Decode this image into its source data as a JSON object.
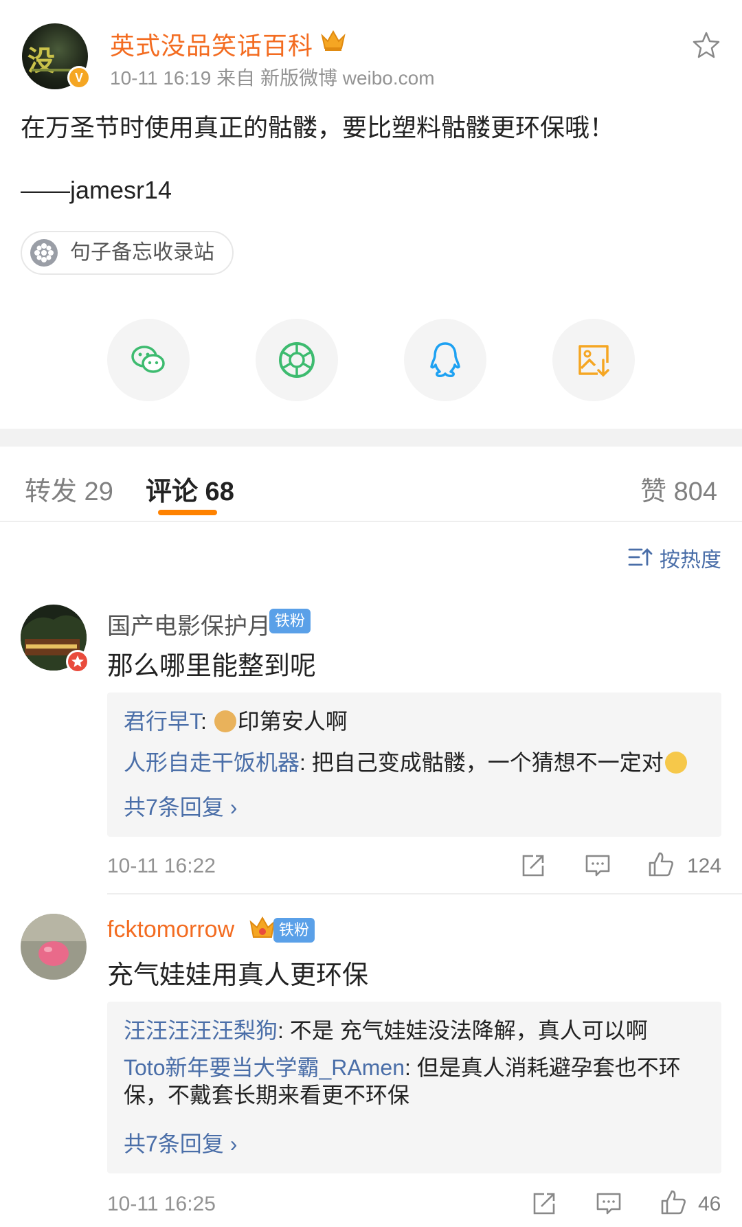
{
  "post": {
    "author_name": "英式没品笑话百科",
    "vip_badge": "V",
    "avatar_title": "没",
    "meta": "10-11 16:19  来自 新版微博 weibo.com",
    "text": "在万圣节时使用真正的骷髅，要比塑料骷髅更环保哦！",
    "signature": "——jamesr14",
    "topic": "句子备忘收录站"
  },
  "share": [
    {
      "icon": "wechat-icon",
      "color": "#3dbb6f"
    },
    {
      "icon": "moments-icon",
      "color": "#3dbb6f"
    },
    {
      "icon": "qq-icon",
      "color": "#1da1f2"
    },
    {
      "icon": "save-image-icon",
      "color": "#f5a623"
    }
  ],
  "tabs": {
    "repost": "转发 29",
    "comments": "评论 68",
    "likes": "赞 804"
  },
  "sort": {
    "label": "按热度"
  },
  "comments": [
    {
      "name": "国产电影保护月",
      "badge": "铁粉",
      "text": "那么哪里能整到呢",
      "replies": [
        {
          "user": "君行早T",
          "text": "印第安人啊"
        },
        {
          "user": "人形自走干饭机器",
          "text": "把自己变成骷髅，一个猜想不一定对"
        }
      ],
      "more": "共7条回复 ›",
      "time": "10-11 16:22",
      "likes": "124"
    },
    {
      "name": "fcktomorrow",
      "badge": "铁粉",
      "text": "充气娃娃用真人更环保",
      "replies": [
        {
          "user": "汪汪汪汪汪梨狗",
          "text": "不是 充气娃娃没法降解，真人可以啊"
        },
        {
          "user": "Toto新年要当大学霸_RAmen",
          "text": "但是真人消耗避孕套也不环保，不戴套长期来看更不环保"
        }
      ],
      "more": "共7条回复 ›",
      "time": "10-11 16:25",
      "likes": "46"
    }
  ],
  "colors": {
    "accent_orange": "#ff8200",
    "author_orange": "#f36c21",
    "link_blue": "#4a6ea8",
    "fan_badge_blue": "#5aa0e8"
  }
}
